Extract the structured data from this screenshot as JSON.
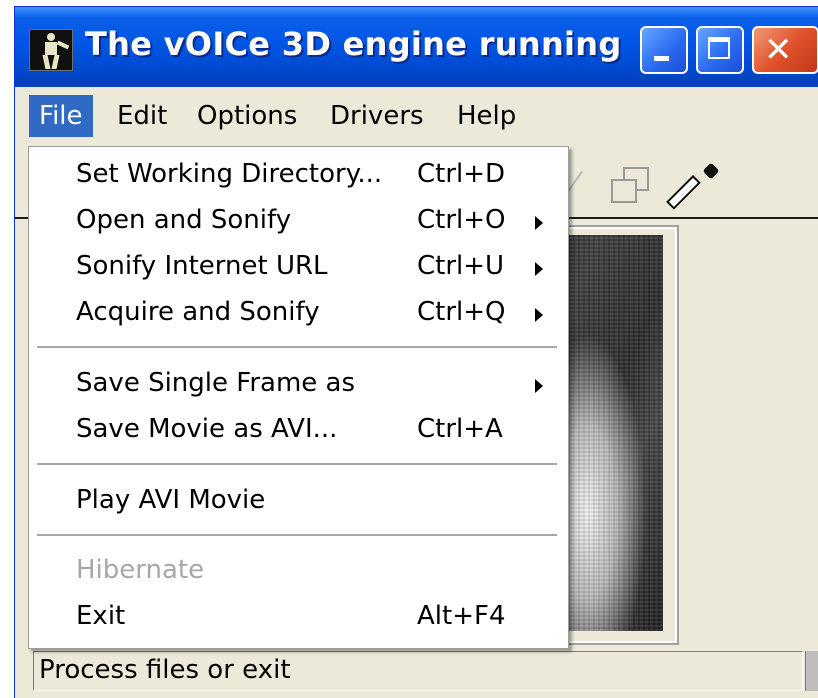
{
  "window": {
    "title": "The vOICe 3D engine running",
    "icons": {
      "app": "voice-app-icon",
      "minimize": "minimize-icon",
      "maximize": "maximize-icon",
      "close": "close-icon",
      "close_glyph": "✕"
    }
  },
  "menubar": {
    "items": [
      {
        "label": "File"
      },
      {
        "label": "Edit"
      },
      {
        "label": "Options"
      },
      {
        "label": "Drivers"
      },
      {
        "label": "Help"
      }
    ]
  },
  "toolbar": {
    "icons": [
      "pen-icon",
      "window-icon",
      "eyedropper-icon"
    ]
  },
  "file_menu": {
    "items": [
      {
        "label": "Set Working Directory...",
        "shortcut": "Ctrl+D",
        "submenu": false
      },
      {
        "label": "Open and Sonify",
        "shortcut": "Ctrl+O",
        "submenu": true
      },
      {
        "label": "Sonify Internet URL",
        "shortcut": "Ctrl+U",
        "submenu": true
      },
      {
        "label": "Acquire and Sonify",
        "shortcut": "Ctrl+Q",
        "submenu": true
      },
      {
        "label": "Save Single Frame as",
        "shortcut": "",
        "submenu": true
      },
      {
        "label": "Save Movie as AVI...",
        "shortcut": "Ctrl+A",
        "submenu": false
      },
      {
        "label": "Play AVI Movie",
        "shortcut": "",
        "submenu": false
      },
      {
        "label": "Hibernate",
        "shortcut": "",
        "submenu": false,
        "disabled": true
      },
      {
        "label": "Exit",
        "shortcut": "Alt+F4",
        "submenu": false
      }
    ]
  },
  "statusbar": {
    "text": "Process files or exit"
  },
  "colors": {
    "title_blue": "#0054e3",
    "menu_highlight": "#316ac5",
    "window_bg": "#ece9d8",
    "close_red": "#e0532a"
  }
}
